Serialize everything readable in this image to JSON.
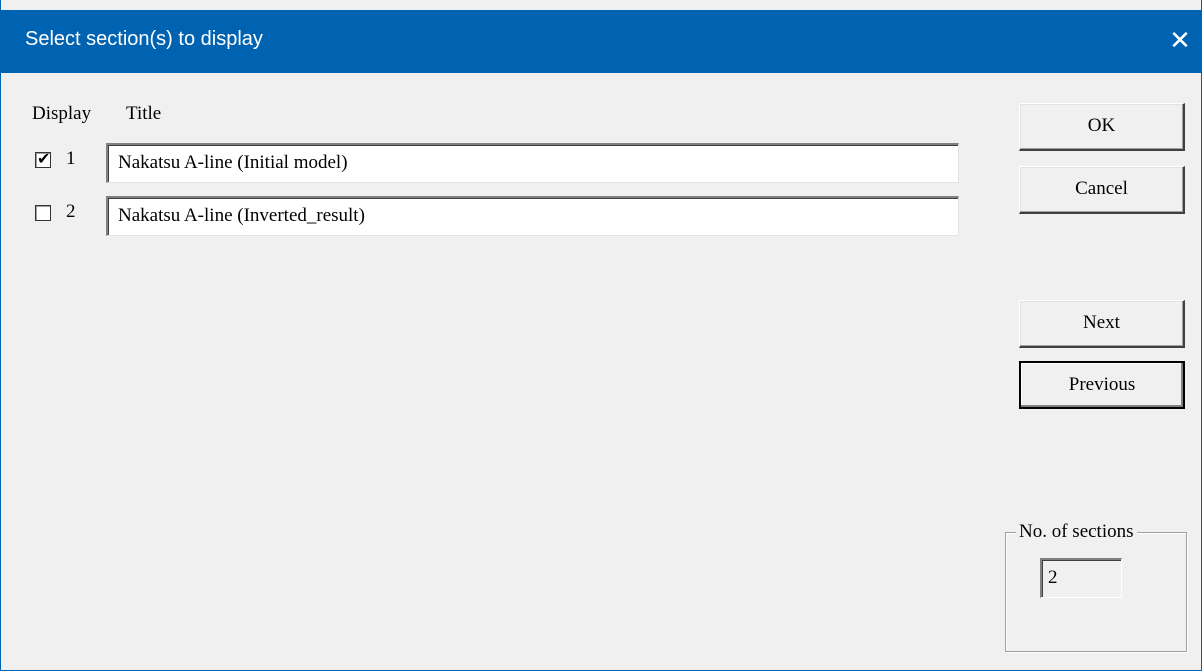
{
  "window": {
    "title": "Select section(s) to display",
    "close_glyph": "✕",
    "close_icon": "close-icon"
  },
  "columns": {
    "display": "Display",
    "title": "Title"
  },
  "sections": [
    {
      "number": "1",
      "checked": true,
      "title": "Nakatsu A-line (Initial model)"
    },
    {
      "number": "2",
      "checked": false,
      "title": "Nakatsu A-line (Inverted_result)"
    }
  ],
  "buttons": {
    "ok": "OK",
    "cancel": "Cancel",
    "next": "Next",
    "previous": "Previous"
  },
  "sections_count": {
    "label": "No. of sections",
    "value": "2"
  },
  "colors": {
    "titlebar": "#0063b1",
    "dialog_bg": "#f0f0f0"
  }
}
